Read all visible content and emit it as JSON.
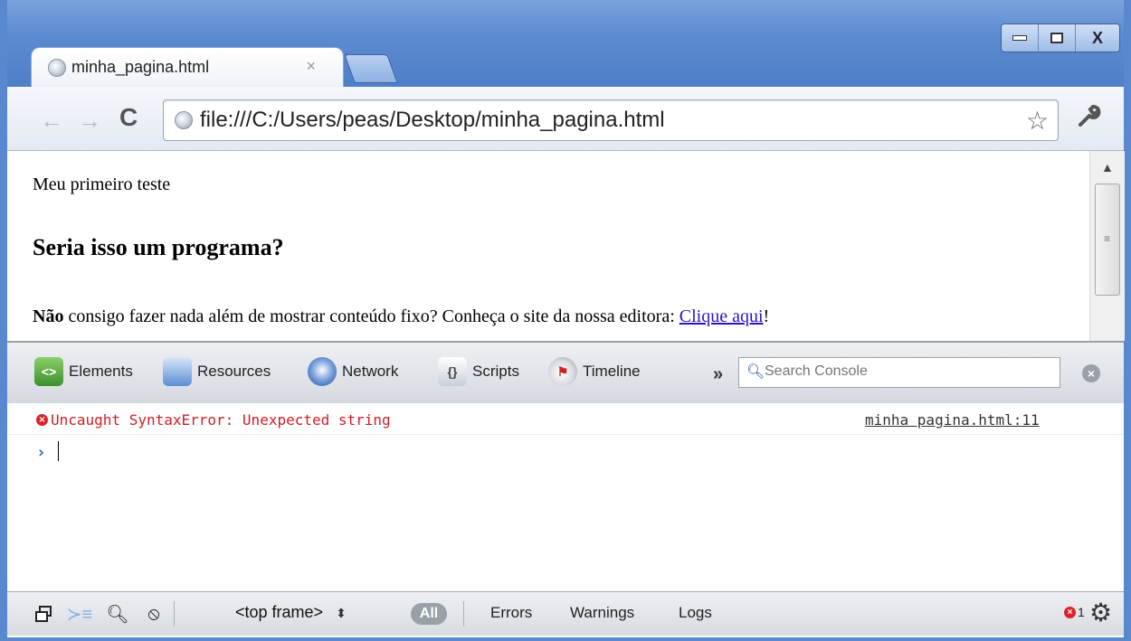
{
  "window": {
    "controls": {
      "minimize": "–",
      "maximize": "□",
      "close": "X"
    }
  },
  "tab": {
    "title": "minha_pagina.html",
    "close_icon": "×"
  },
  "toolbar": {
    "back_icon": "←",
    "forward_icon": "→",
    "reload_icon": "C",
    "url": "file:///C:/Users/peas/Desktop/minha_pagina.html",
    "star_icon": "☆",
    "wrench_icon": "🔧"
  },
  "page": {
    "paragraph1": "Meu primeiro teste",
    "heading": "Seria isso um programa?",
    "paragraph2_bold": "Não",
    "paragraph2_text": " consigo fazer nada além de mostrar conteúdo fixo? Conheça o site da nossa editora: ",
    "link_text": "Clique aqui",
    "paragraph2_end": "!"
  },
  "devtools": {
    "tabs": [
      {
        "label": "Elements",
        "icon": "elements-icon"
      },
      {
        "label": "Resources",
        "icon": "resources-icon"
      },
      {
        "label": "Network",
        "icon": "network-icon"
      },
      {
        "label": "Scripts",
        "icon": "scripts-icon"
      },
      {
        "label": "Timeline",
        "icon": "timeline-icon"
      }
    ],
    "more": "»",
    "search_placeholder": "Search Console"
  },
  "console": {
    "error_message": "Uncaught SyntaxError: Unexpected string",
    "error_source": "minha pagina.html:11",
    "prompt": "›"
  },
  "statusbar": {
    "frame": "<top frame>",
    "all": "All",
    "filters": [
      "Errors",
      "Warnings",
      "Logs"
    ],
    "error_count": "1"
  },
  "colors": {
    "titlebar": "#5d8bd0",
    "error": "#d31d24",
    "link": "#2a14c6"
  }
}
